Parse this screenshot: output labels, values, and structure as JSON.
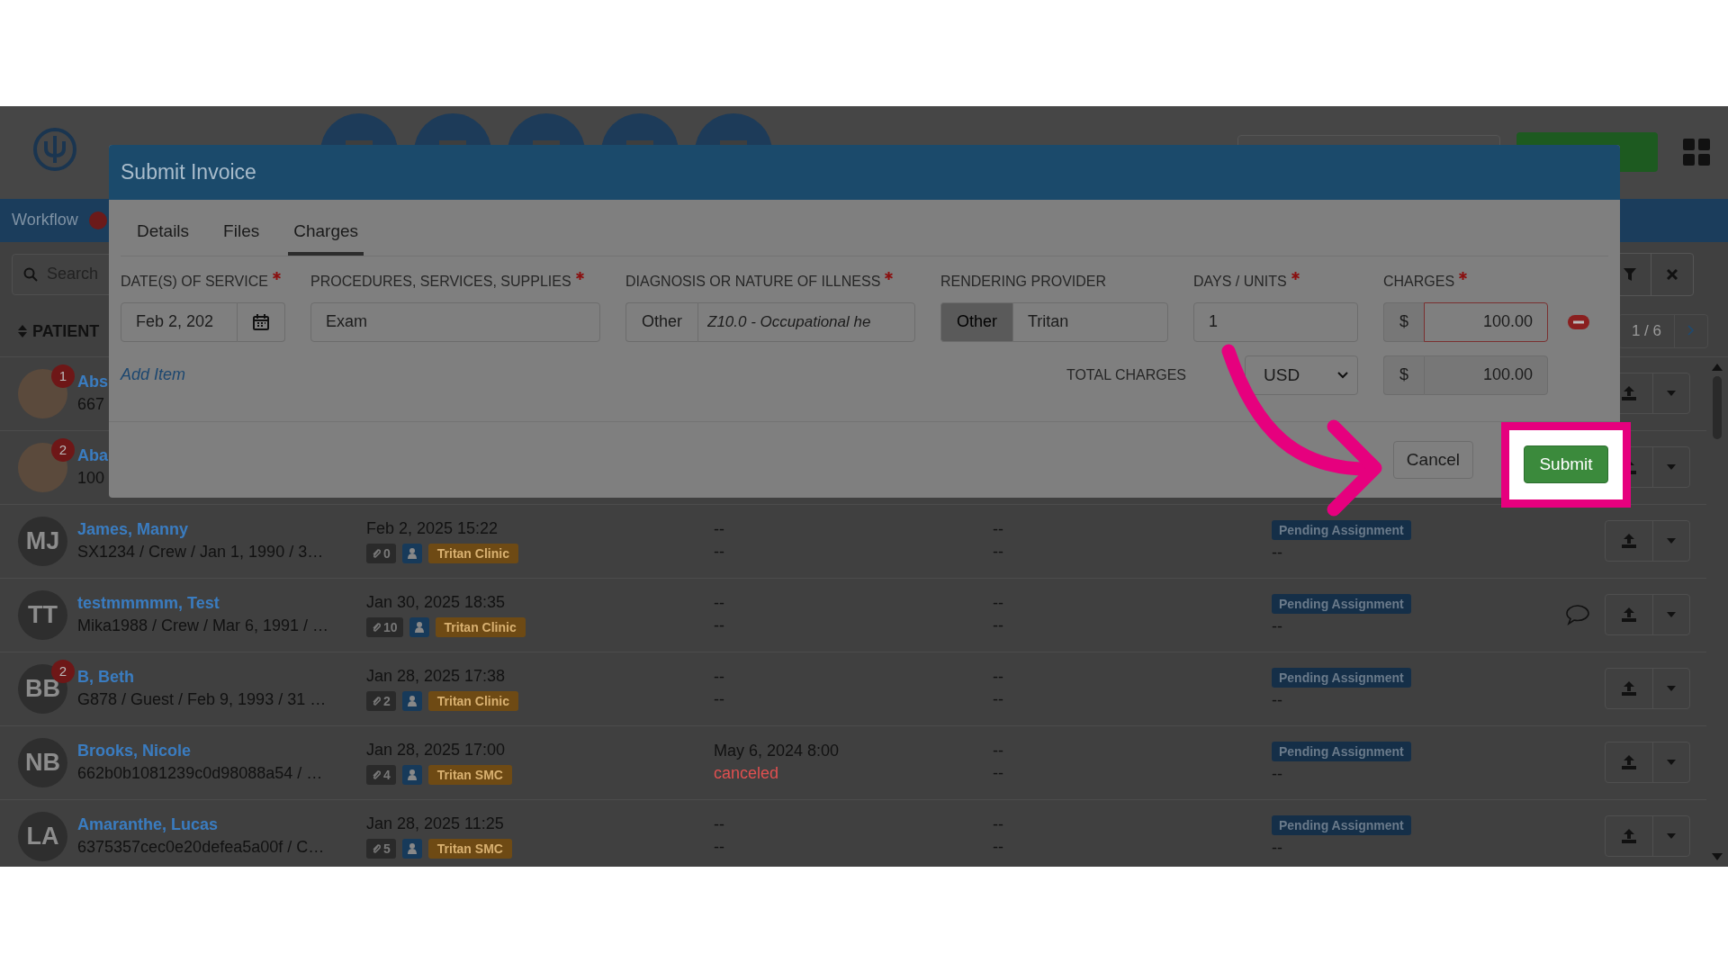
{
  "nav": {
    "label": "Workflow"
  },
  "search": {
    "placeholder": "Search"
  },
  "table": {
    "column_1": "PATIENT",
    "pager": "1 / 6",
    "rows": [
      {
        "kind": "hidden",
        "initials": "",
        "badge": "1",
        "name": "Abs",
        "sub": "667"
      },
      {
        "kind": "hidden",
        "initials": "",
        "badge": "2",
        "name": "Aba",
        "sub": "100"
      },
      {
        "kind": "full",
        "initials": "MJ",
        "name": "James, Manny",
        "sub": "SX1234 / Crew / Jan 1, 1990 / 3…",
        "date": "Feb 2, 2025 15:22",
        "attachments": "0",
        "clinic": "Tritan Clinic",
        "col_3": [
          {
            "text": "--",
            "kind": "plain"
          },
          {
            "text": "--",
            "kind": "plain"
          }
        ],
        "col_4": [
          "--",
          "--"
        ],
        "status": "Pending Assignment",
        "status_note": "--",
        "comment": false
      },
      {
        "kind": "full",
        "initials": "TT",
        "name": "testmmmmm, Test",
        "sub": "Mika1988 / Crew / Mar 6, 1991 / …",
        "date": "Jan 30, 2025 18:35",
        "attachments": "10",
        "clinic": "Tritan Clinic",
        "col_3": [
          {
            "text": "--",
            "kind": "plain"
          },
          {
            "text": "--",
            "kind": "plain"
          }
        ],
        "col_4": [
          "--",
          "--"
        ],
        "status": "Pending Assignment",
        "status_note": "--",
        "comment": true
      },
      {
        "kind": "full",
        "initials": "BB",
        "badge": "2",
        "name": "B, Beth",
        "sub": "G878 / Guest / Feb 9, 1993 / 31 …",
        "date": "Jan 28, 2025 17:38",
        "attachments": "2",
        "clinic": "Tritan Clinic",
        "col_3": [
          {
            "text": "--",
            "kind": "plain"
          },
          {
            "text": "--",
            "kind": "plain"
          }
        ],
        "col_4": [
          "--",
          "--"
        ],
        "status": "Pending Assignment",
        "status_note": "--",
        "comment": false
      },
      {
        "kind": "full",
        "initials": "NB",
        "name": "Brooks, Nicole",
        "sub": "662b0b1081239c0d98088a54 / …",
        "date": "Jan 28, 2025 17:00",
        "attachments": "4",
        "clinic": "Tritan SMC",
        "col_3": [
          {
            "text": "May 6, 2024 8:00",
            "kind": "plain"
          },
          {
            "text": "canceled",
            "kind": "alert"
          }
        ],
        "col_4": [
          "--",
          "--"
        ],
        "status": "Pending Assignment",
        "status_note": "--",
        "comment": false
      },
      {
        "kind": "full",
        "initials": "LA",
        "name": "Amaranthe, Lucas",
        "sub": "6375357cec0e20defea5a00f / C…",
        "date": "Jan 28, 2025 11:25",
        "attachments": "5",
        "clinic": "Tritan SMC",
        "col_3": [
          {
            "text": "--",
            "kind": "plain"
          },
          {
            "text": "--",
            "kind": "plain"
          }
        ],
        "col_4": [
          "--",
          "--"
        ],
        "status": "Pending Assignment",
        "status_note": "--",
        "comment": false
      }
    ]
  },
  "modal": {
    "title": "Submit Invoice",
    "tabs": [
      {
        "label": "Details",
        "selected": false
      },
      {
        "label": "Files",
        "selected": false
      },
      {
        "label": "Charges",
        "selected": true
      }
    ],
    "fields": [
      {
        "kind": "date",
        "label": "DATE(S) OF SERVICE",
        "required": true,
        "value": "Feb 2, 202"
      },
      {
        "kind": "text",
        "label": "PROCEDURES, SERVICES, SUPPLIES",
        "required": true,
        "value": "Exam"
      },
      {
        "kind": "addon",
        "label": "DIAGNOSIS OR NATURE OF ILLNESS",
        "required": true,
        "addon": "Other",
        "addon_selected": false,
        "value": "Z10.0 - Occupational he",
        "italic": true
      },
      {
        "kind": "addon",
        "label": "RENDERING PROVIDER",
        "required": false,
        "addon": "Other",
        "addon_selected": true,
        "value": "Tritan",
        "italic": false
      },
      {
        "kind": "text",
        "label": "DAYS / UNITS",
        "required": true,
        "value": "1"
      },
      {
        "kind": "money",
        "label": "CHARGES",
        "required": true,
        "prefix": "$",
        "value": "100.00",
        "invalid": true
      }
    ],
    "add_item": "Add Item",
    "total": {
      "label": "TOTAL CHARGES",
      "currency": "USD",
      "prefix": "$",
      "value": "100.00"
    },
    "cancel": "Cancel",
    "submit": "Submit"
  }
}
